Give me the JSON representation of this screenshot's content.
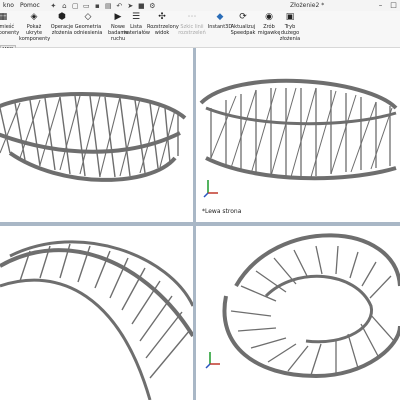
{
  "menubar": {
    "items": [
      "kno",
      "Pomoc"
    ],
    "doc_title": "Złożenie2 *"
  },
  "ribbon": {
    "buttons": [
      {
        "label": "rozmieść komponenty",
        "icon": "arrange-icon",
        "disabled": false
      },
      {
        "label": "Pokaż ukryte komponenty",
        "icon": "show-hidden-icon",
        "disabled": false
      },
      {
        "label": "Operacje złożenia",
        "icon": "assembly-features-icon",
        "disabled": false
      },
      {
        "label": "Geometria odniesienia",
        "icon": "reference-geometry-icon",
        "disabled": false
      },
      {
        "label": "Nowe badanie ruchu",
        "icon": "motion-study-icon",
        "disabled": false
      },
      {
        "label": "Lista materiałów",
        "icon": "bom-icon",
        "disabled": false
      },
      {
        "label": "Rozstrzelony widok",
        "icon": "exploded-view-icon",
        "disabled": false
      },
      {
        "label": "Szkic linii rozstrzeleń",
        "icon": "explode-line-icon",
        "disabled": true
      },
      {
        "label": "Instant3D",
        "icon": "instant3d-icon",
        "disabled": false
      },
      {
        "label": "Aktualizuj Speedpak",
        "icon": "speedpak-icon",
        "disabled": false
      },
      {
        "label": "Zrób migawkę",
        "icon": "snapshot-icon",
        "disabled": false
      },
      {
        "label": "Tryb dużego złożenia",
        "icon": "large-assembly-icon",
        "disabled": false
      }
    ]
  },
  "left_tab": "MBD",
  "viewports": {
    "top_right_label": "*Lewa strona"
  },
  "colors": {
    "background": "#ffffff",
    "divider": "#a9b7c6",
    "model": "#6e6e6e"
  }
}
